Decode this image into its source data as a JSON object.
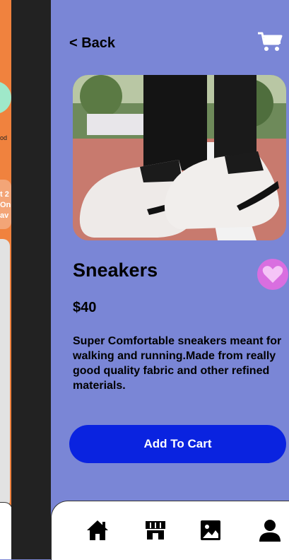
{
  "left_peek": {
    "label_small": "od",
    "badge_lines": [
      "t 2",
      "On",
      "av"
    ]
  },
  "header": {
    "back_label": "< Back",
    "cart_icon": "cart-icon"
  },
  "product": {
    "name": "Sneakers",
    "price": "$40",
    "description": "Super Comfortable sneakers meant for walking and running.Made from really good quality fabric and other refined materials.",
    "favorite_icon": "heart-icon",
    "add_to_cart_label": "Add To Cart"
  },
  "bottom_nav": {
    "items": [
      "home-icon",
      "store-icon",
      "gallery-icon",
      "profile-icon"
    ]
  },
  "colors": {
    "background": "#7a86d6",
    "button": "#0a23e0",
    "heart": "#d96ee0",
    "left_panel": "#f0823e"
  }
}
